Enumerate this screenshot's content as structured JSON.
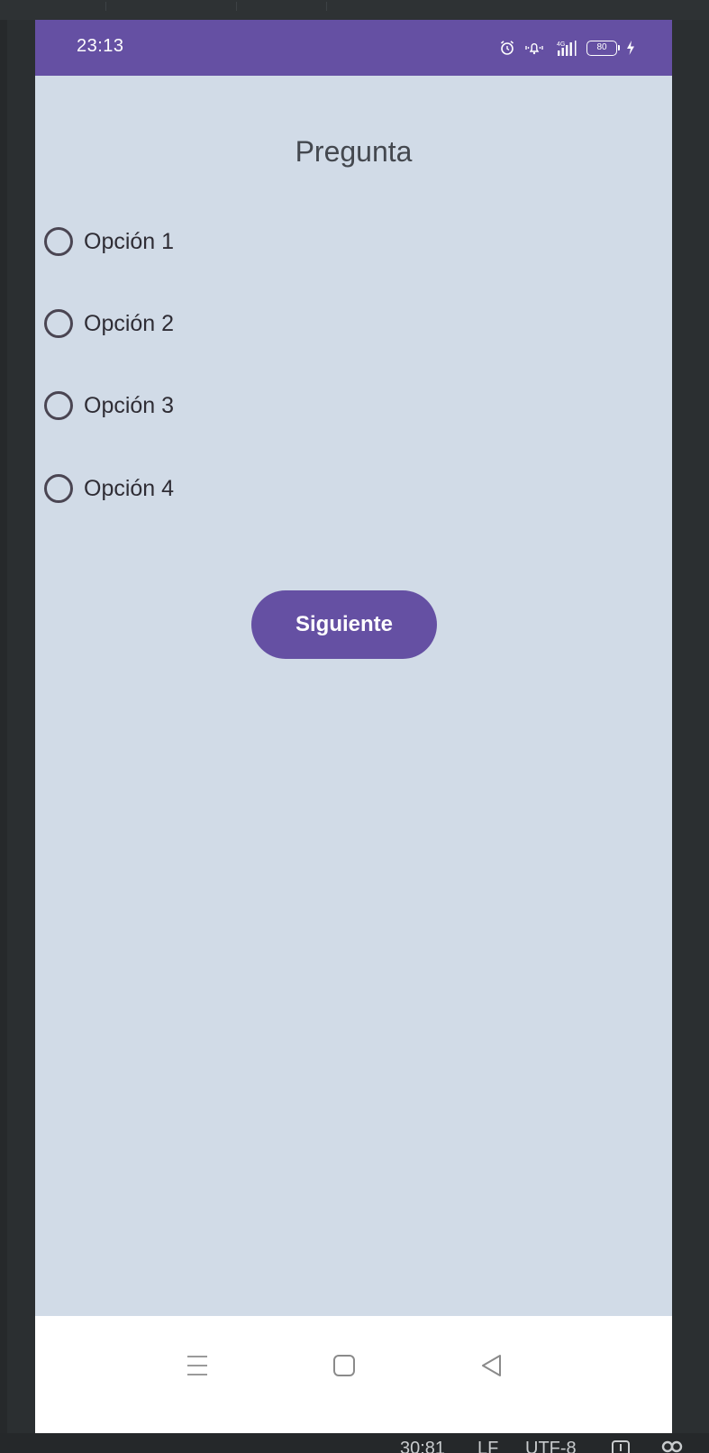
{
  "status_bar": {
    "time": "23:13",
    "battery_level": "80",
    "icons": [
      "alarm-icon",
      "vibrate-icon",
      "signal-4g-icon",
      "battery-icon",
      "charging-icon"
    ]
  },
  "question": {
    "title": "Pregunta",
    "options": [
      {
        "label": "Opción 1",
        "selected": false
      },
      {
        "label": "Opción 2",
        "selected": false
      },
      {
        "label": "Opción 3",
        "selected": false
      },
      {
        "label": "Opción 4",
        "selected": false
      }
    ]
  },
  "actions": {
    "next_label": "Siguiente"
  },
  "nav_bar": {
    "buttons": [
      "menu-icon",
      "home-icon",
      "back-icon"
    ]
  },
  "ide_status": {
    "cursor_position": "30:81",
    "line_separator": "LF",
    "encoding": "UTF-8"
  },
  "colors": {
    "primary": "#6550a3",
    "background": "#d1dbe7",
    "ide_dark": "#2b2f31"
  }
}
